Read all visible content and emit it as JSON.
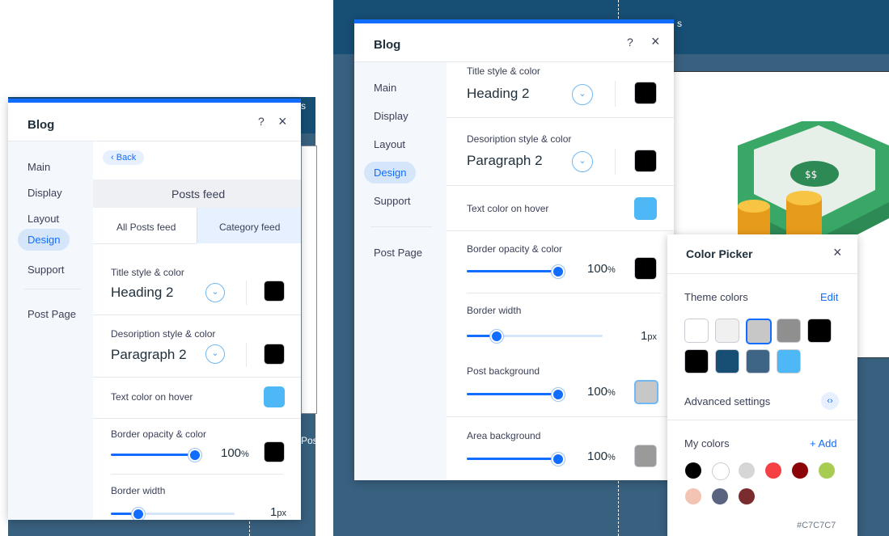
{
  "left": {
    "title": "Blog",
    "help_icon": "?",
    "close_icon": "×",
    "nav": [
      {
        "label": "Main"
      },
      {
        "label": "Display"
      },
      {
        "label": "Layout"
      },
      {
        "label": "Design"
      },
      {
        "label": "Support"
      },
      {
        "label": "Post Page"
      }
    ],
    "back_label": "Back",
    "section_title": "Posts feed",
    "tabs": [
      {
        "label": "All Posts feed"
      },
      {
        "label": "Category feed"
      }
    ],
    "title_style_label": "Title style & color",
    "title_style_value": "Heading 2",
    "desc_style_label": "Desoription style & color",
    "desc_style_value": "Paragraph 2",
    "hover_label": "Text color on hover",
    "border_opacity_label": "Border opacity & color",
    "border_opacity_value": "100",
    "border_width_label": "Border width",
    "border_width_value": "1",
    "unit_percent": "%",
    "unit_px": "px",
    "behind_text_1": "s",
    "behind_text_2": "Pos",
    "border_opacity_level": 1.0,
    "border_width_level": 0.22
  },
  "right": {
    "title": "Blog",
    "help_icon": "?",
    "close_icon": "×",
    "nav": [
      {
        "label": "Main"
      },
      {
        "label": "Display"
      },
      {
        "label": "Layout"
      },
      {
        "label": "Design"
      },
      {
        "label": "Support"
      },
      {
        "label": "Post Page"
      }
    ],
    "title_style_label": "Title style & color",
    "title_style_value": "Heading 2",
    "desc_style_label": "Desoription style & color",
    "desc_style_value": "Paragraph 2",
    "hover_label": "Text color on hover",
    "border_opacity_label": "Border opacity & color",
    "border_opacity_value": "100",
    "border_width_label": "Border width",
    "border_width_value": "1",
    "post_bg_label": "Post background",
    "post_bg_value": "100",
    "area_bg_label": "Area background",
    "area_bg_value": "100",
    "unit_percent": "%",
    "unit_px": "px",
    "behind_text": "s",
    "border_opacity_level": 1.0,
    "border_width_level": 0.22,
    "post_bg_level": 1.0,
    "area_bg_level": 1.0
  },
  "color_picker": {
    "title": "Color Picker",
    "close_icon": "×",
    "theme_label": "Theme colors",
    "edit_label": "Edit",
    "theme_colors": [
      "#ffffff",
      "#f0f0f0",
      "#c7c7c7",
      "#8f8f8f",
      "#000000",
      "#000000",
      "#174e74",
      "#3e6586",
      "#4eb7f5"
    ],
    "advanced_label": "Advanced settings",
    "my_colors_label": "My colors",
    "add_label": "+ Add",
    "my_colors": [
      "#000000",
      "#ffffff",
      "#d6d6d6",
      "#f64144",
      "#8b0508",
      "#a8cc51",
      "#f3c3b3",
      "#5a6480",
      "#7a2c2f"
    ],
    "hex_value": "#C7C7C7"
  },
  "colors": {
    "accent": "#116dff",
    "editor_bg": "#38607f",
    "dark_header": "#174e74",
    "hover_swatch": "#4eb7f5",
    "post_bg_swatch": "#c7c7c7",
    "area_bg_swatch": "#9a9a9a"
  }
}
